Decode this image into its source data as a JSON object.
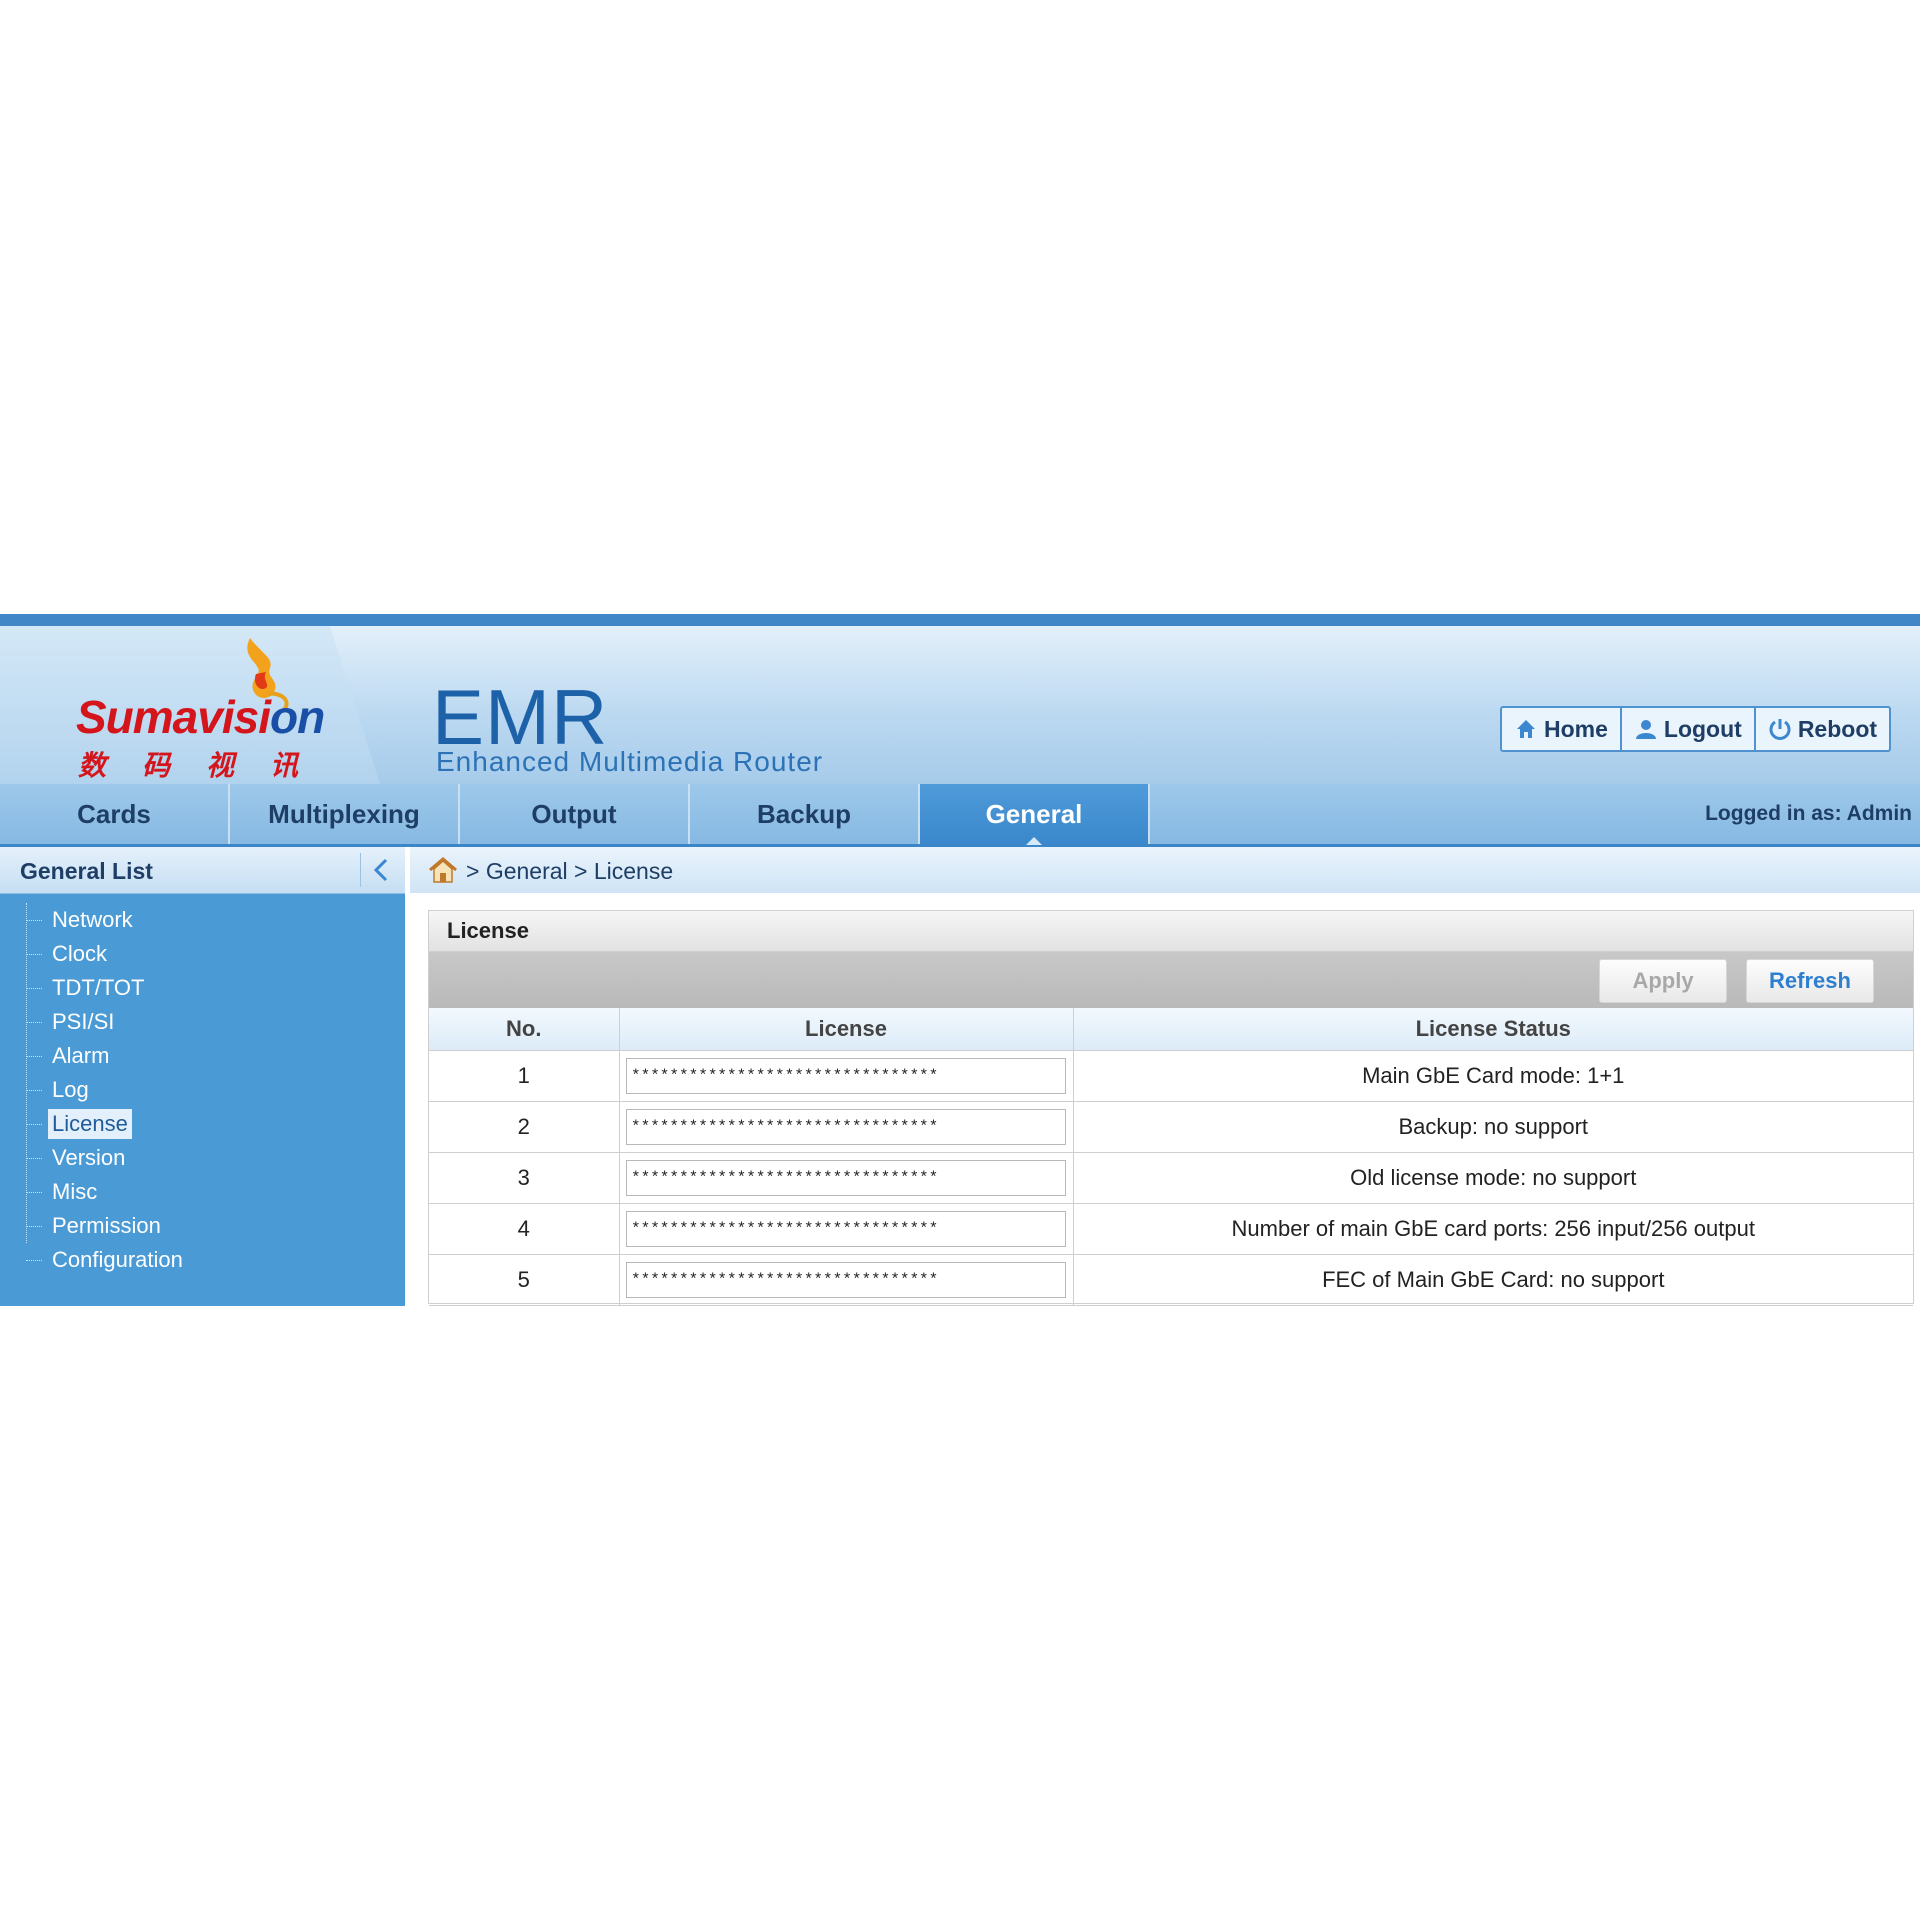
{
  "brand": {
    "logo_text_main": "Sumavisi",
    "logo_text_tail": "on",
    "logo_chinese": "数码视讯",
    "product": "EMR",
    "product_subtitle": "Enhanced Multimedia Router"
  },
  "header_buttons": {
    "home": "Home",
    "logout": "Logout",
    "reboot": "Reboot"
  },
  "nav": {
    "tabs": [
      {
        "label": "Cards"
      },
      {
        "label": "Multiplexing"
      },
      {
        "label": "Output"
      },
      {
        "label": "Backup"
      },
      {
        "label": "General",
        "active": true
      }
    ],
    "logged_in": "Logged in as: Admin"
  },
  "sidebar": {
    "title": "General List",
    "items": [
      {
        "label": "Network"
      },
      {
        "label": "Clock"
      },
      {
        "label": "TDT/TOT"
      },
      {
        "label": "PSI/SI"
      },
      {
        "label": "Alarm"
      },
      {
        "label": "Log"
      },
      {
        "label": "License",
        "selected": true
      },
      {
        "label": "Version"
      },
      {
        "label": "Misc"
      },
      {
        "label": "Permission"
      },
      {
        "label": "Configuration"
      }
    ]
  },
  "breadcrumb": "> General > License",
  "panel": {
    "title": "License",
    "apply_label": "Apply",
    "refresh_label": "Refresh",
    "columns": [
      "No.",
      "License",
      "License Status"
    ],
    "rows": [
      {
        "no": "1",
        "license": "********************************",
        "status": "Main GbE Card mode: 1+1"
      },
      {
        "no": "2",
        "license": "********************************",
        "status": "Backup: no support"
      },
      {
        "no": "3",
        "license": "********************************",
        "status": "Old license mode: no support"
      },
      {
        "no": "4",
        "license": "********************************",
        "status": "Number of main GbE card ports: 256 input/256 output"
      },
      {
        "no": "5",
        "license": "********************************",
        "status": "FEC of Main GbE Card: no support"
      }
    ]
  },
  "colors": {
    "accent": "#3a87cb",
    "sidebar": "#4a9ad6",
    "logo_red": "#d4161c",
    "logo_blue": "#1a4fa8"
  }
}
